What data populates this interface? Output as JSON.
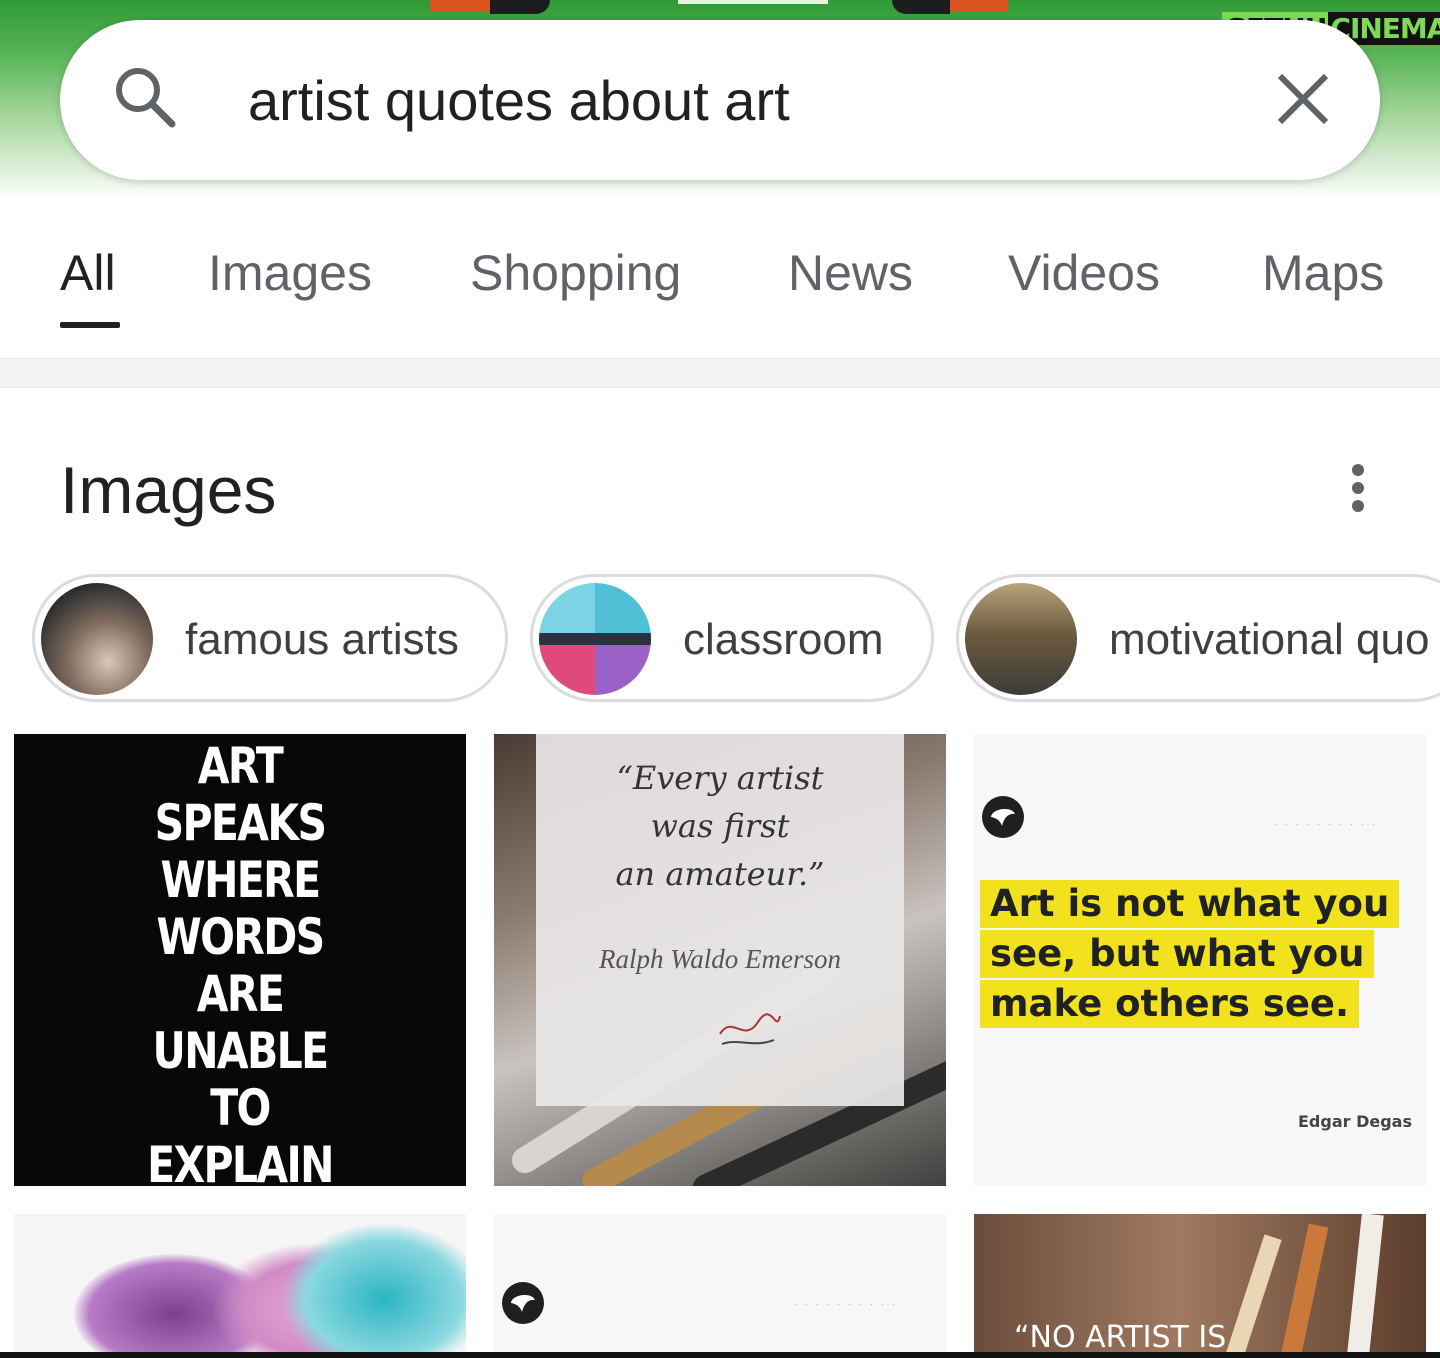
{
  "watermark": {
    "part1": "GETHU",
    "part2": "CINEMA"
  },
  "search": {
    "query": "artist quotes about art"
  },
  "tabs": [
    {
      "label": "All",
      "active": true
    },
    {
      "label": "Images"
    },
    {
      "label": "Shopping"
    },
    {
      "label": "News"
    },
    {
      "label": "Videos"
    },
    {
      "label": "Maps"
    }
  ],
  "images_section": {
    "title": "Images",
    "chips": [
      {
        "label": "famous artists"
      },
      {
        "label": "classroom"
      },
      {
        "label": "motivational quo"
      }
    ],
    "results": [
      {
        "text": "ART\nSPEAKS\nWHERE\nWORDS\nARE\nUNABLE\nTO\nEXPLAIN"
      },
      {
        "quote": "“Every artist\nwas first\nan amateur.”",
        "author": "Ralph Waldo Emerson"
      },
      {
        "lines": [
          "Art is not what you",
          "see, but what you",
          "make others see."
        ],
        "author": "Edgar Degas"
      },
      {},
      {},
      {
        "text": "“NO ARTIST IS"
      }
    ]
  },
  "colors": {
    "header_green": "#2f9a36",
    "highlight_yellow": "#f2e21d",
    "accent_dark": "#202124"
  }
}
